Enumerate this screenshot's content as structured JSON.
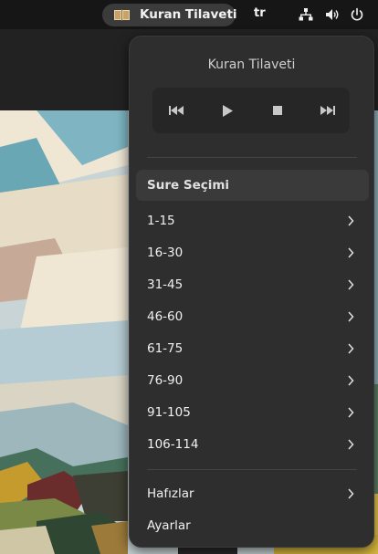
{
  "topbar": {
    "app_indicator": {
      "label": "Kuran Tilaveti",
      "icon": "book-icon"
    },
    "keyboard_layout": "tr",
    "tray": {
      "network_icon": "network-wired-icon",
      "volume_icon": "volume-icon",
      "power_icon": "power-icon"
    }
  },
  "menu": {
    "title": "Kuran Tilaveti",
    "player": {
      "previous_icon": "skip-previous-icon",
      "play_icon": "play-icon",
      "stop_icon": "stop-icon",
      "next_icon": "skip-next-icon"
    },
    "section_header": "Sure Seçimi",
    "ranges": [
      {
        "label": "1-15"
      },
      {
        "label": "16-30"
      },
      {
        "label": "31-45"
      },
      {
        "label": "46-60"
      },
      {
        "label": "61-75"
      },
      {
        "label": "76-90"
      },
      {
        "label": "91-105"
      },
      {
        "label": "106-114"
      }
    ],
    "hafizlar": "Hafızlar",
    "ayarlar": "Ayarlar"
  },
  "colors": {
    "topbar_bg": "#161616",
    "menu_bg": "#2e2e2e",
    "accent_pill": "#3b3b3b"
  }
}
